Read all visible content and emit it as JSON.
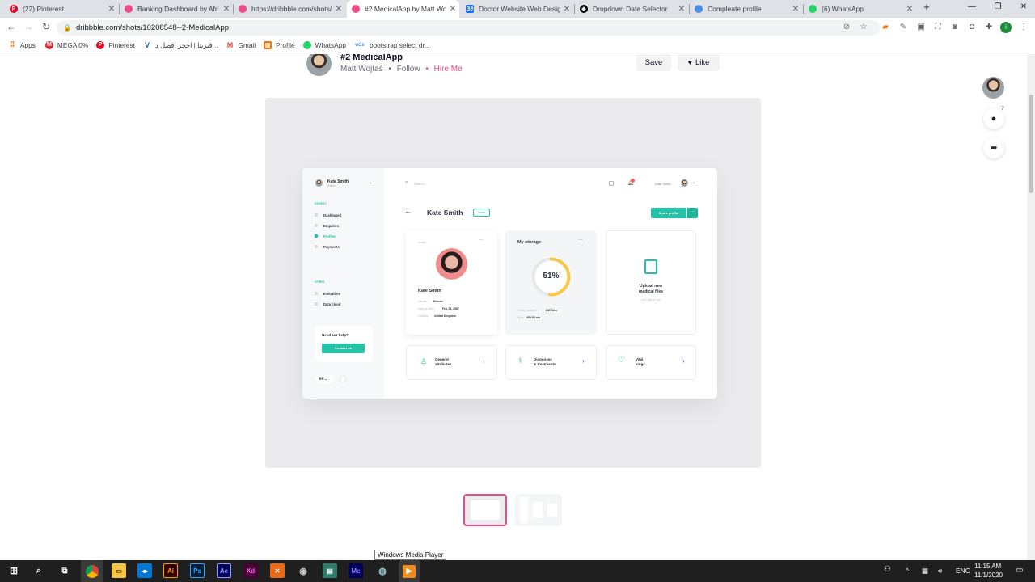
{
  "browser": {
    "tabs": [
      {
        "title": "(22) Pinterest",
        "icon": "pinterest-icon",
        "color": "#e60023"
      },
      {
        "title": "Banking Dashboard by Afri",
        "icon": "dribbble-icon",
        "color": "#ea4c89"
      },
      {
        "title": "https://dribbble.com/shots/",
        "icon": "dribbble-icon",
        "color": "#ea4c89"
      },
      {
        "title": "#2 MedicalApp by Matt Wo",
        "icon": "dribbble-icon",
        "color": "#ea4c89"
      },
      {
        "title": "Doctor Website Web Design",
        "icon": "behance-icon",
        "color": "#1769ff"
      },
      {
        "title": "Dropdown Date Selector",
        "icon": "codepen-icon",
        "color": "#000000"
      },
      {
        "title": "Compleate profile",
        "icon": "page-icon",
        "color": "#4a90e2"
      },
      {
        "title": "(6) WhatsApp",
        "icon": "whatsapp-icon",
        "color": "#25d366"
      }
    ],
    "url": "dribbble.com/shots/10208548--2-MedicalApp",
    "profile_initial": "i",
    "bookmarks": [
      {
        "label": "Apps",
        "icon": "apps-grid-icon",
        "color": "#e8710a"
      },
      {
        "label": "MEGA 0%",
        "icon": "mega-icon",
        "color": "#d9272e"
      },
      {
        "label": "Pinterest",
        "icon": "pinterest-icon",
        "color": "#e60023"
      },
      {
        "label": "فيزيتا | احجز أفضل د...",
        "icon": "vezeeta-icon",
        "color": "#1a5dab"
      },
      {
        "label": "Gmail",
        "icon": "gmail-icon",
        "color": "#ea4335"
      },
      {
        "label": "Profile",
        "icon": "profile-icon",
        "color": "#e8710a"
      },
      {
        "label": "WhatsApp",
        "icon": "whatsapp-icon",
        "color": "#25d366"
      },
      {
        "label": "bootstrap select dr...",
        "icon": "w3-icon",
        "color": "#4a90e2"
      }
    ]
  },
  "shot": {
    "title": "#2 MedicalApp",
    "author": "Matt Wojtaś",
    "follow": "Follow",
    "hire": "Hire Me",
    "save": "Save",
    "like": "Like",
    "comment_count": "7"
  },
  "app": {
    "user_name": "Kate Smith",
    "user_role": "Patient",
    "section_patient": "PATIENT",
    "nav": [
      "Dashboard",
      "Enquiries",
      "Profiles",
      "Payments"
    ],
    "section_other": "OTHER",
    "nav_other": [
      "Invitations",
      "Data cloud"
    ],
    "help_title": "Need our help?",
    "help_button": "Contact us",
    "lang": "EN",
    "search_placeholder": "Search...",
    "header_user": "Kate Smith",
    "page_title": "Kate Smith",
    "badge": "Active",
    "share_button": "Share profile",
    "profile_card_label": "Image",
    "profile_name": "Kate Smith",
    "details": [
      {
        "label": "Gender:",
        "value": "Female"
      },
      {
        "label": "Date of Birth:",
        "value": "Feb 13, 1987"
      },
      {
        "label": "Country:",
        "value": "United Kingdom"
      }
    ],
    "storage_title": "My storage",
    "storage_percent": 51,
    "storage_percent_label": "51%",
    "storage_rows": [
      {
        "label": "Health records:",
        "value": "245 files"
      },
      {
        "label": "Size:",
        "value": "459.53 mb"
      }
    ],
    "upload_title_1": "Upload new",
    "upload_title_2": "medical files",
    "upload_sub": "Left: 544.47 mb",
    "tiles": [
      {
        "line1": "General",
        "line2": "attributes",
        "icon": "person-icon"
      },
      {
        "line1": "Diagnoses",
        "line2": "& treatments",
        "icon": "stethoscope-icon"
      },
      {
        "line1": "Vital",
        "line2": "sings",
        "icon": "heart-icon"
      }
    ],
    "accent": "#22c3a6",
    "ring_color": "#f7c948"
  },
  "taskbar": {
    "apps": [
      {
        "label": "Ai",
        "icon": "illustrator-icon",
        "color": "#ff9a00"
      },
      {
        "label": "Ps",
        "icon": "photoshop-icon",
        "color": "#31a8ff"
      },
      {
        "label": "Ae",
        "icon": "after-effects-icon",
        "color": "#9999ff"
      },
      {
        "label": "Xd",
        "icon": "xd-icon",
        "color": "#ff61f6"
      },
      {
        "label": "Me",
        "icon": "media-encoder-icon",
        "color": "#8f7bff"
      }
    ],
    "tooltip": "Windows Media Player",
    "lang": "ENG",
    "time": "11:15 AM",
    "date": "11/1/2020"
  }
}
